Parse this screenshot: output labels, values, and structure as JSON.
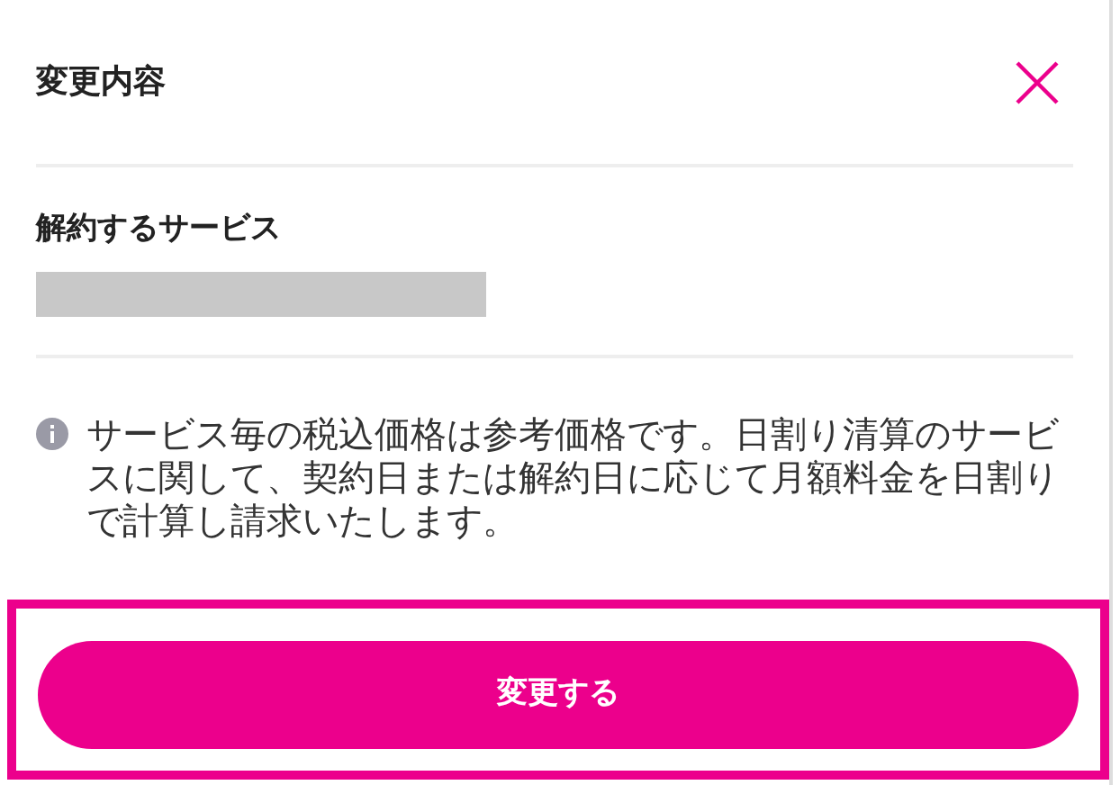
{
  "header": {
    "title": "変更内容"
  },
  "section": {
    "label": "解約するサービス"
  },
  "note": "サービス毎の税込価格は参考価格です。日割り清算のサービスに関して、契約日または解約日に応じて月額料金を日割りで計算し請求いたします。",
  "button": {
    "label": "変更する"
  }
}
